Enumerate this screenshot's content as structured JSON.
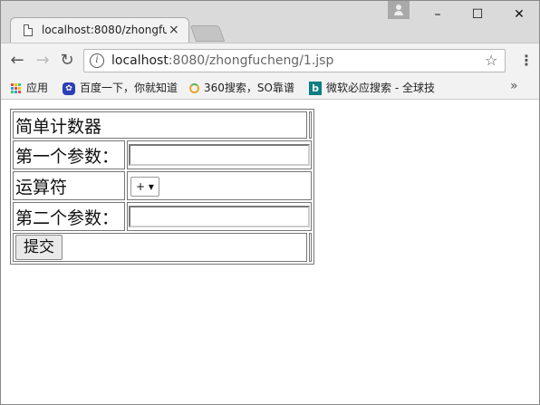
{
  "browser": {
    "tab_title": "localhost:8080/zhongfu",
    "tab_close": "×",
    "window_controls": {
      "minimize": "–",
      "maximize": "☐",
      "close": "✕"
    },
    "url_host": "localhost",
    "url_rest": ":8080/zhongfucheng/1.jsp",
    "nav": {
      "back": "←",
      "forward": "→",
      "reload": "↻"
    },
    "star_icon": "☆",
    "menu_icon": "⋮"
  },
  "bookmarks": {
    "items": [
      {
        "label": "应用",
        "icon": "apps-icon"
      },
      {
        "label": "百度一下，你就知道",
        "icon": "baidu-paw-icon"
      },
      {
        "label": "360搜索，SO靠谱",
        "icon": "360-ring-icon"
      },
      {
        "label": "微软必应搜索 - 全球技",
        "icon": "bing-icon"
      }
    ],
    "more": "»"
  },
  "form": {
    "title": "简单计数器",
    "param1_label": "第一个参数：",
    "param1_value": "",
    "operator_label": "运算符",
    "operator_selected": "+ ▾",
    "param2_label": "第二个参数：",
    "param2_value": "",
    "submit_label": "提交"
  }
}
